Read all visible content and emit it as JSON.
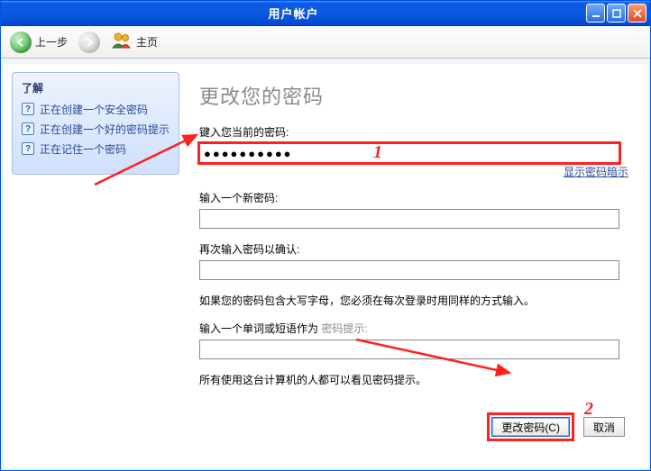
{
  "window": {
    "title": "用户帐户"
  },
  "toolbar": {
    "back": "上一步",
    "home": "主页"
  },
  "sidebar": {
    "heading": "了解",
    "items": [
      "正在创建一个安全密码",
      "正在创建一个好的密码提示",
      "正在记住一个密码"
    ]
  },
  "main": {
    "heading": "更改您的密码",
    "current_pw_label": "键入您当前的密码:",
    "current_pw_value": "●●●●●●●●●●",
    "show_hint_link": "显示密码暗示",
    "new_pw_label": "输入一个新密码:",
    "confirm_pw_label": "再次输入密码以确认:",
    "caps_note": "如果您的密码包含大写字母，您必须在每次登录时用同样的方式输入。",
    "hint_label_prefix": "输入一个单词或短语作为 ",
    "hint_label_gray": "密码提示:",
    "visibility_note": "所有使用这台计算机的人都可以看见密码提示。",
    "submit_label": "更改密码(C)",
    "cancel_label": "取消"
  },
  "annotations": {
    "step1": "1",
    "step2": "2"
  }
}
